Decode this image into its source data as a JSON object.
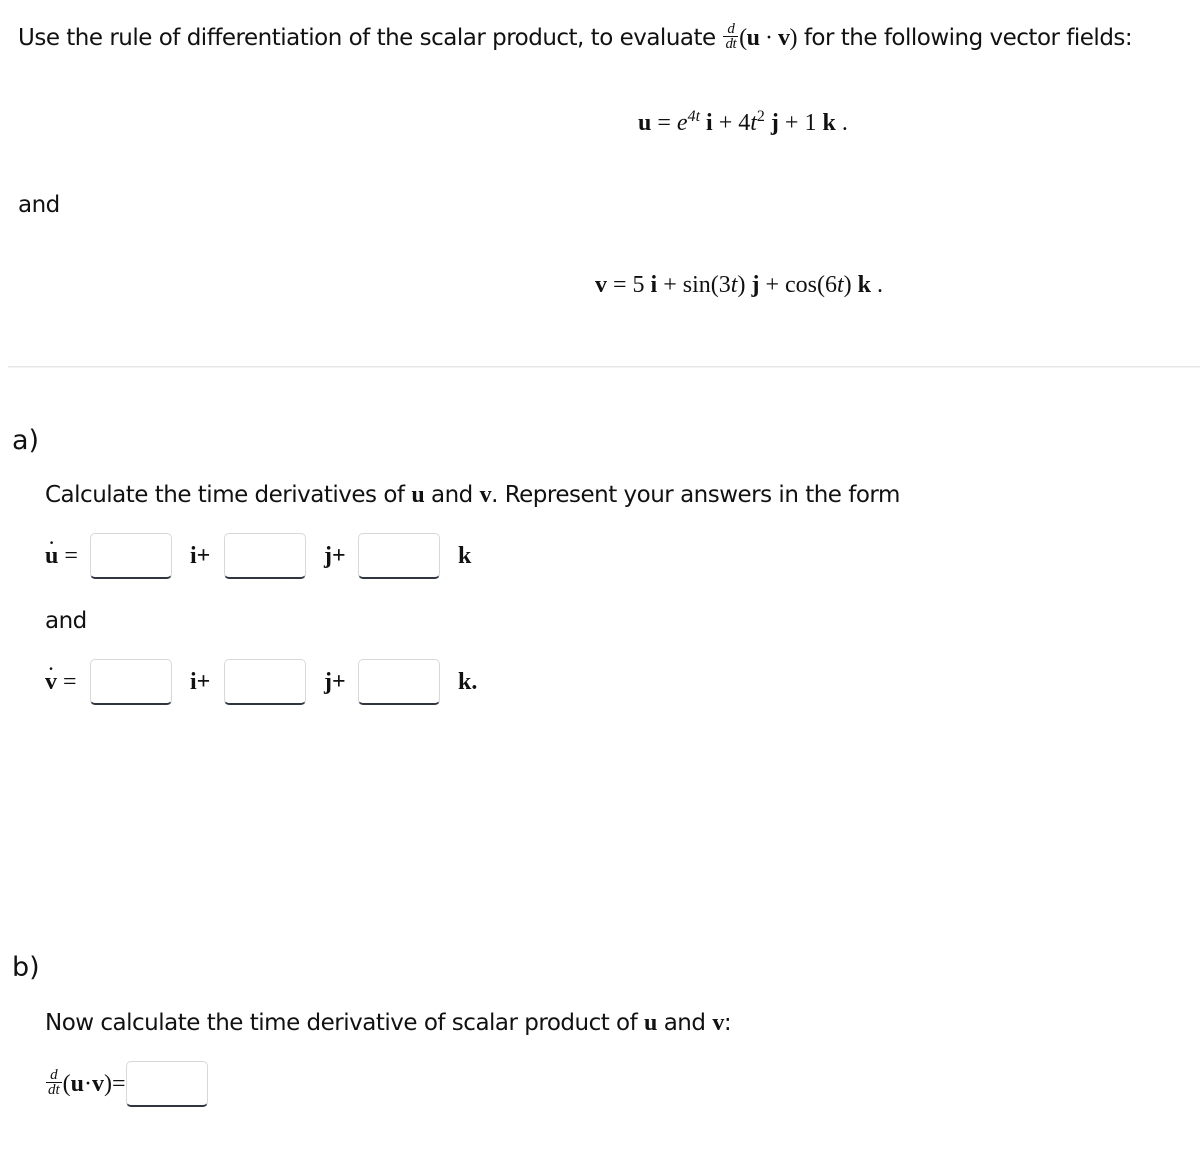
{
  "intro": {
    "text_before": "Use the rule of differentiation of the scalar product, to evaluate ",
    "frac_num": "d",
    "frac_den": "dt",
    "expr": "(",
    "u": "u",
    "dot": " · ",
    "v": "v",
    "expr_close": ")",
    "text_after": " for the following vector fields:"
  },
  "equation_u": {
    "lhs": "u",
    "eq": " = ",
    "term1_base": "e",
    "term1_exp": "4t",
    "i": "i",
    "plus1": " + ",
    "term2_coef": "4",
    "term2_var": "t",
    "term2_exp": "2",
    "j": "j",
    "plus2": " + ",
    "term3": "1",
    "k": "k",
    "end": " ."
  },
  "connector_and_1": "and",
  "equation_v": {
    "lhs": "v",
    "eq": " = ",
    "term1": "5",
    "i": "i",
    "plus1": " + ",
    "term2_fn": "sin(3",
    "term2_var": "t",
    "term2_close": ")",
    "j": "j",
    "plus2": " + ",
    "term3_fn": "cos(6",
    "term3_var": "t",
    "term3_close": ")",
    "k": "k",
    "end": " ."
  },
  "part_a": {
    "label": "a)",
    "prompt_before": "Calculate the time derivatives of ",
    "prompt_u": "u",
    "prompt_and": " and ",
    "prompt_v": "v",
    "prompt_after": ". Represent your answers in the form",
    "u_row": {
      "lhs_symbol": "u",
      "lhs_dot": "˙",
      "eq": " =",
      "unit_i": "i+",
      "unit_j": "j+",
      "unit_k": "k",
      "inputs": [
        {
          "value": "",
          "placeholder": ""
        },
        {
          "value": "",
          "placeholder": ""
        },
        {
          "value": "",
          "placeholder": ""
        }
      ]
    },
    "connector_and": "and",
    "v_row": {
      "lhs_symbol": "v",
      "lhs_dot": "˙",
      "eq": " =",
      "unit_i": "i+",
      "unit_j": "j+",
      "unit_k": "k.",
      "inputs": [
        {
          "value": "",
          "placeholder": ""
        },
        {
          "value": "",
          "placeholder": ""
        },
        {
          "value": "",
          "placeholder": ""
        }
      ]
    }
  },
  "part_b": {
    "label": "b)",
    "prompt_before": "Now calculate the time derivative of scalar product of ",
    "prompt_u": "u",
    "prompt_and": " and ",
    "prompt_v": "v",
    "prompt_after": ":",
    "lhs": {
      "frac_num": "d",
      "frac_den": "dt",
      "open": "(",
      "u": "u",
      "dot": " · ",
      "v": "v",
      "close": ")=",
      "input": {
        "value": "",
        "placeholder": ""
      }
    }
  }
}
